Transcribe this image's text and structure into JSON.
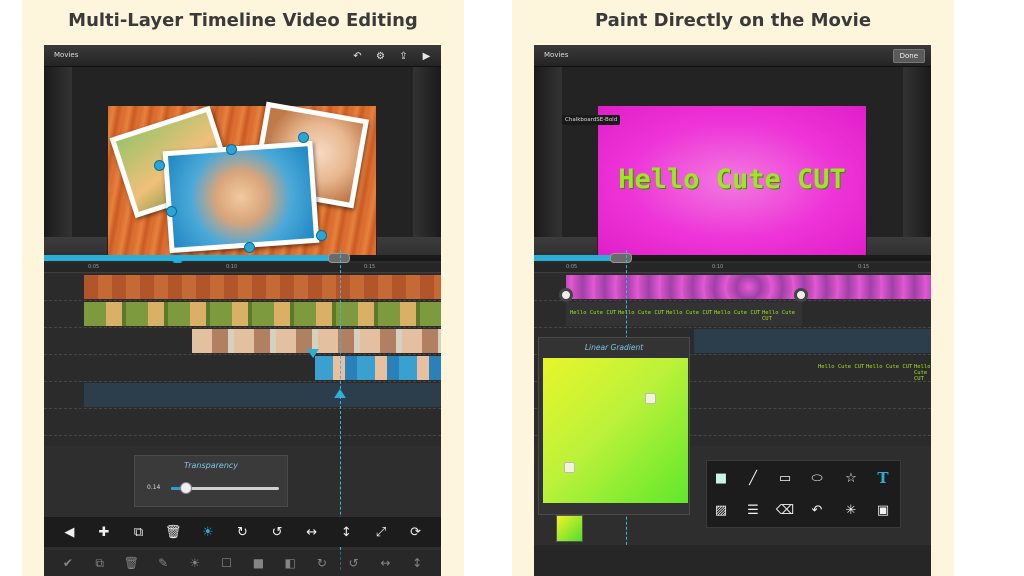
{
  "left_panel": {
    "heading": "Multi-Layer Timeline Video Editing",
    "top_bar": {
      "title": "Movies"
    },
    "ruler_ticks": [
      "0:05",
      "0:10",
      "0:15"
    ],
    "transparency": {
      "label": "Transparency",
      "value": "0.14",
      "level": 0.14
    },
    "toolbar_icons": [
      "arrow-left-icon",
      "plus-icon",
      "duplicate-icon",
      "trash-icon",
      "brightness-icon",
      "redo-icon",
      "undo-icon",
      "flip-horizontal-icon",
      "flip-vertical-icon",
      "resize-icon",
      "refresh-icon"
    ]
  },
  "right_panel": {
    "heading": "Paint Directly on the Movie",
    "top_bar": {
      "title": "Movies",
      "done_label": "Done"
    },
    "font_tag": "ChalkboardSE-Bold",
    "movie_text": "Hello Cute CUT",
    "ruler_ticks": [
      "0:05",
      "0:10",
      "0:15"
    ],
    "text_clip_items": [
      "Hello Cute CUT",
      "Hello Cute CUT",
      "Hello Cute CUT",
      "Hello Cute CUT",
      "Hello Cute CUT"
    ],
    "text_clip_items_2": [
      "Hello Cute CUT",
      "Hello Cute CUT",
      "Hello Cute CUT"
    ],
    "gradient_panel": {
      "label": "Linear Gradient"
    },
    "draw_tools": [
      "fill-square-icon",
      "line-icon",
      "rectangle-icon",
      "ellipse-icon",
      "star-icon",
      "text-icon",
      "image-icon",
      "lines-icon",
      "eraser-icon",
      "undo-icon",
      "sparkle-icon",
      "save-icon"
    ],
    "text_tool_glyph": "T"
  },
  "colors": {
    "accent": "#2ab0d8",
    "movie_text": "#9ae820",
    "canvas_magenta": "#ee34d8"
  }
}
